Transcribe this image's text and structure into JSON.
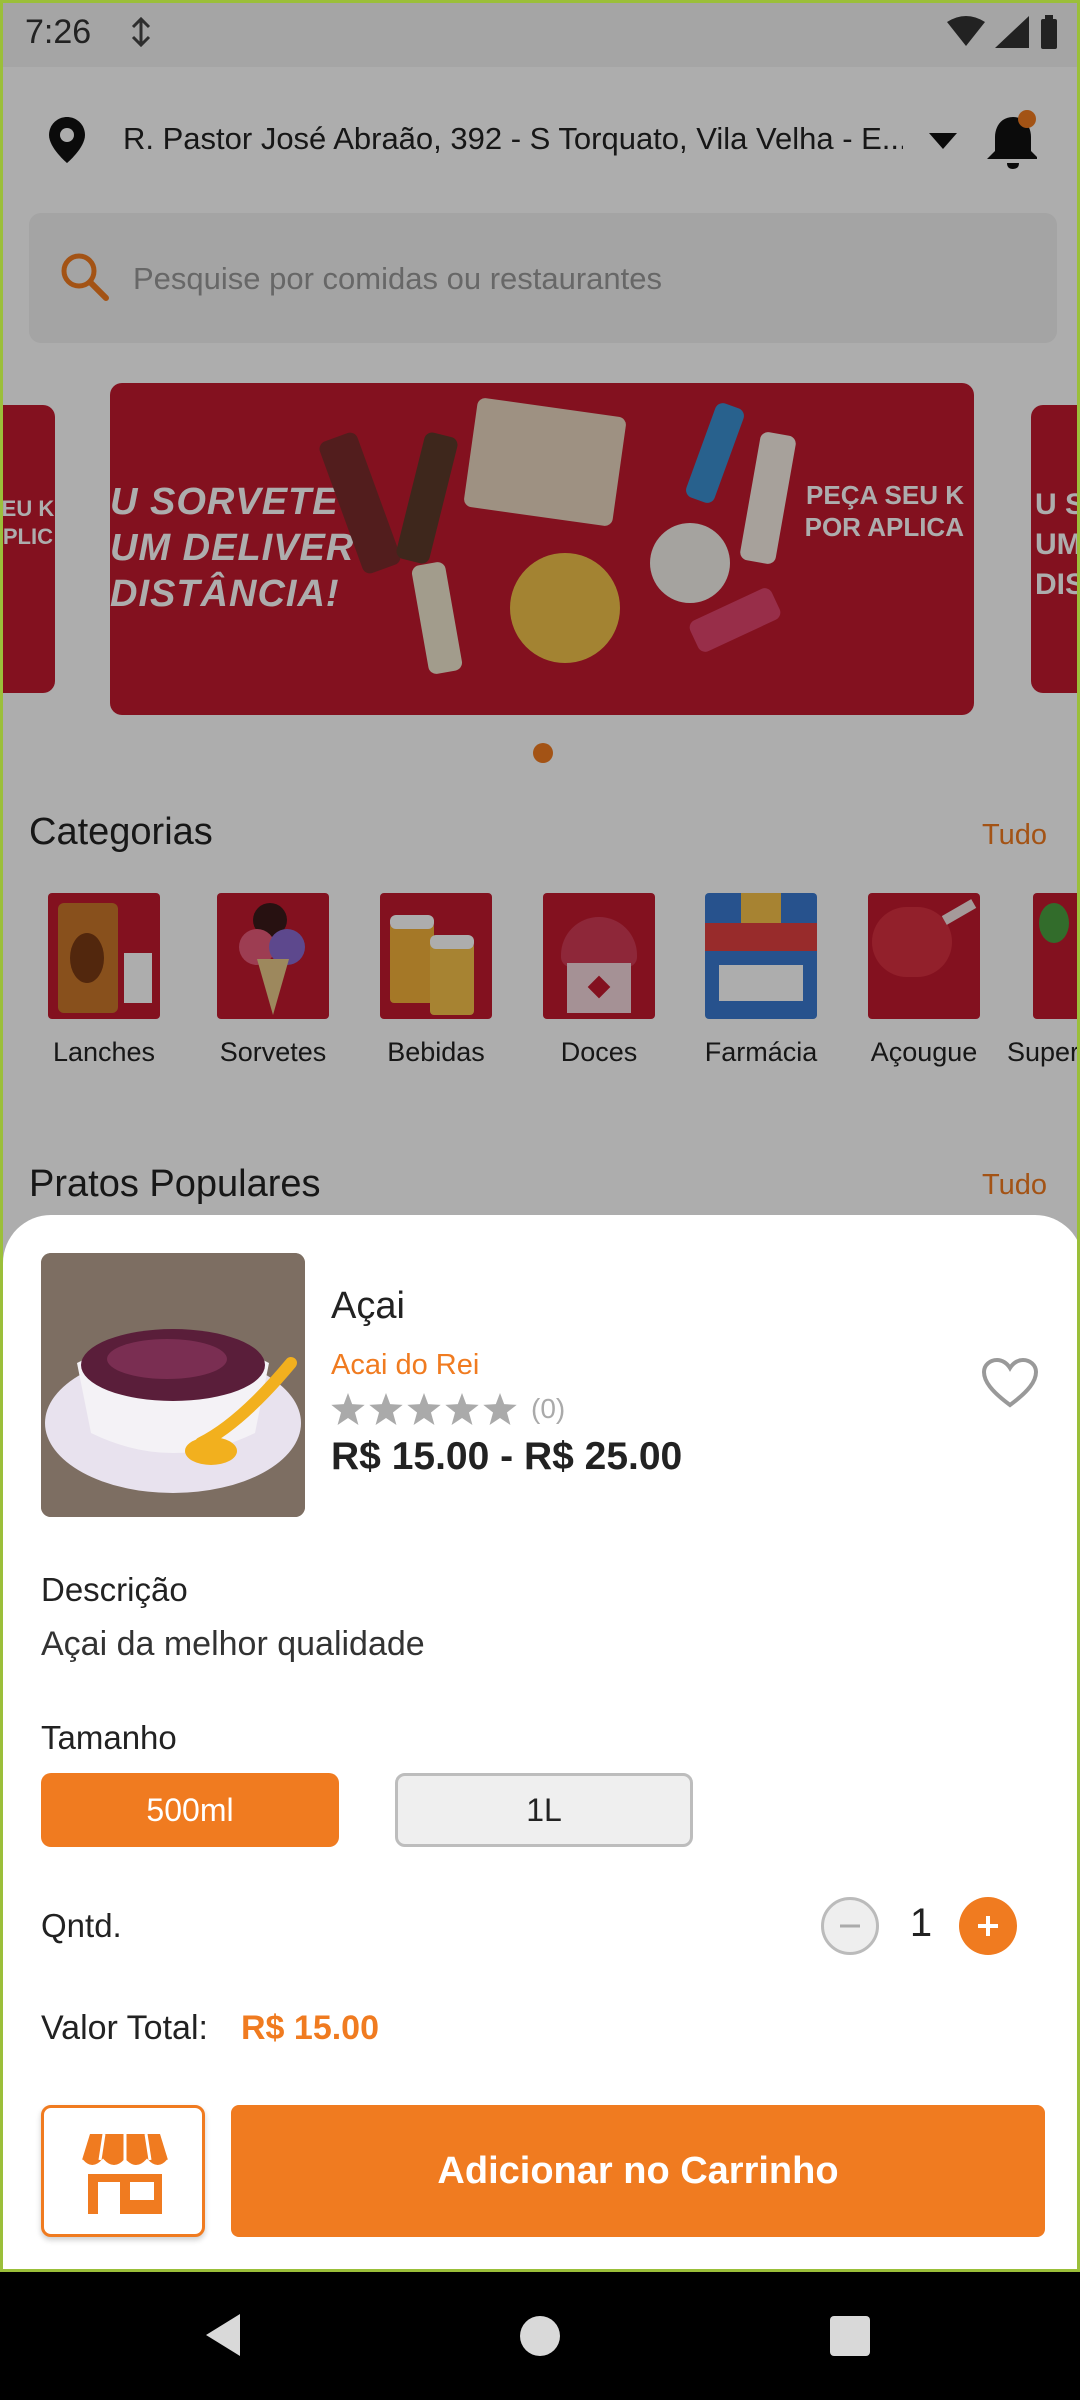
{
  "status_bar": {
    "time": "7:26",
    "extra_icon": "data-saver-icon"
  },
  "location": {
    "address": "R. Pastor José Abraão, 392 - S Torquato, Vila Velha - E..."
  },
  "search": {
    "placeholder": "Pesquise por comidas ou restaurantes"
  },
  "banner": {
    "left_text": "U SORVETE\nUM DELIVERY\nDISTÂNCIA!",
    "right_text": "PEÇA SEU K\nPOR APLICA",
    "peek_left_text": "SEU K\nAPLIC",
    "peek_right_text": "U SO\nUM\nDIS"
  },
  "categories": {
    "title": "Categorias",
    "link": "Tudo",
    "items": [
      {
        "label": "Lanches",
        "icon": "snack-bag-icon"
      },
      {
        "label": "Sorvetes",
        "icon": "ice-cream-icon"
      },
      {
        "label": "Bebidas",
        "icon": "beer-icon"
      },
      {
        "label": "Doces",
        "icon": "cupcake-icon"
      },
      {
        "label": "Farmácia",
        "icon": "pharmacy-icon"
      },
      {
        "label": "Açougue",
        "icon": "meat-icon"
      },
      {
        "label": "Super",
        "icon": "grocery-icon"
      }
    ]
  },
  "popular": {
    "title": "Pratos Populares",
    "link": "Tudo"
  },
  "product": {
    "name": "Açai",
    "store": "Acai do Rei",
    "rating_stars": 0,
    "rating_count": "(0)",
    "price_range": "R$ 15.00 - R$ 25.00",
    "description_label": "Descrição",
    "description": "Açai da melhor qualidade",
    "size_label": "Tamanho",
    "sizes": [
      "500ml",
      "1L"
    ],
    "selected_size": "500ml",
    "qty_label": "Qntd.",
    "qty": "1",
    "total_label": "Valor Total:",
    "total_value": "R$ 15.00",
    "add_button": "Adicionar no Carrinho"
  },
  "colors": {
    "accent": "#f07b20",
    "banner_red": "#c21a2e"
  }
}
